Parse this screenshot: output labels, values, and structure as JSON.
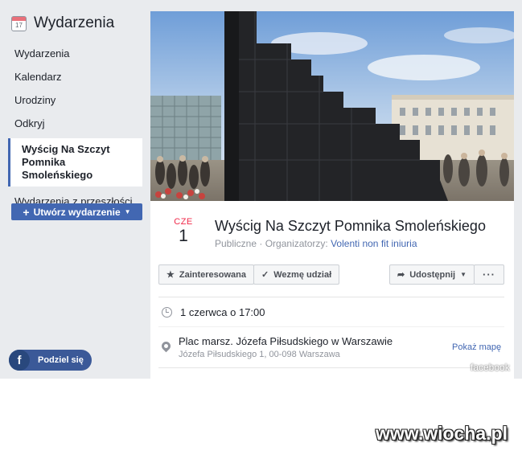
{
  "sidebar": {
    "title": "Wydarzenia",
    "calendar_day": "17",
    "items": [
      {
        "label": "Wydarzenia"
      },
      {
        "label": "Kalendarz"
      },
      {
        "label": "Urodziny"
      },
      {
        "label": "Odkryj"
      },
      {
        "label": "Wyścig Na Szczyt Pomnika Smoleńskiego"
      },
      {
        "label": "Wydarzenia z przeszłości"
      }
    ],
    "create_button": "Utwórz wydarzenie",
    "share_button": "Podziel się"
  },
  "event": {
    "date_month": "CZE",
    "date_day": "1",
    "title": "Wyścig Na Szczyt Pomnika Smoleńskiego",
    "privacy": "Publiczne",
    "organizers_label": "Organizatorzy:",
    "organizer": "Volenti non fit iniuria",
    "buttons": {
      "interested": "Zainteresowana",
      "going": "Wezmę udział",
      "share": "Udostępnij",
      "more": "···"
    },
    "time": "1 czerwca o 17:00",
    "place_name": "Plac marsz. Józefa Piłsudskiego w Warszawie",
    "place_address": "Józefa Piłsudskiego 1, 00-098 Warszawa",
    "map_link": "Pokaż mapę"
  },
  "watermarks": {
    "facebook": "facebook",
    "site": "www.wiocha.pl"
  },
  "colors": {
    "accent": "#4267b2",
    "month": "#f02849",
    "background": "#e9ebee"
  }
}
